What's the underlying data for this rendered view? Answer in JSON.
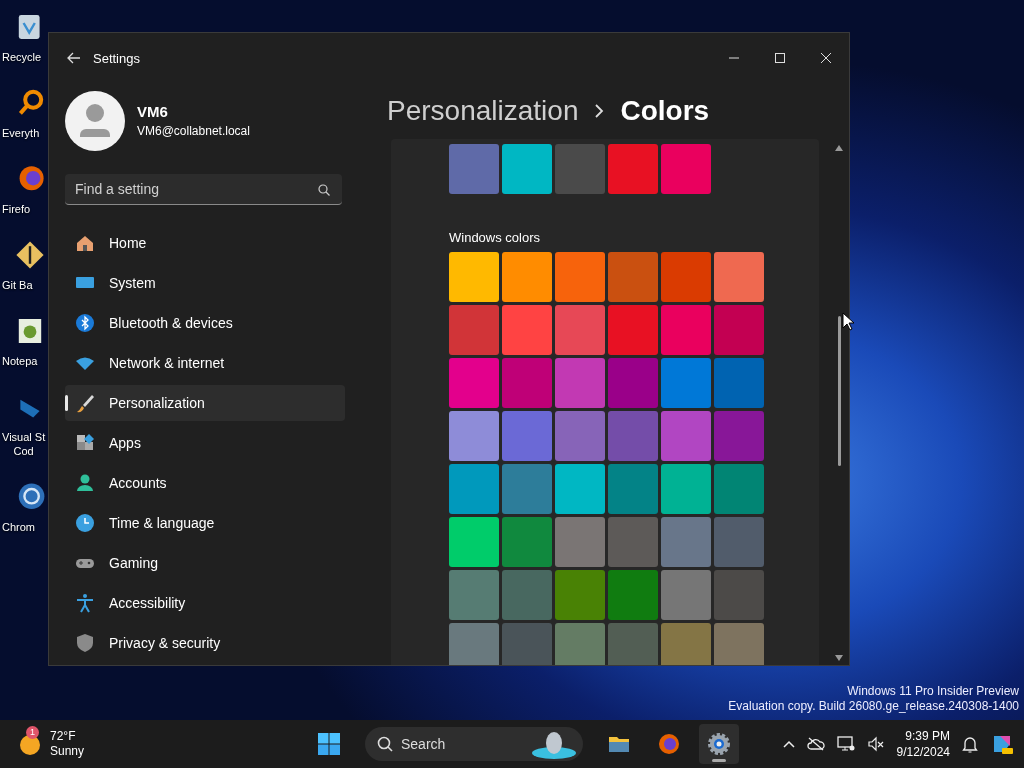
{
  "desktop": {
    "icons": [
      {
        "lines": [
          "Recycle"
        ]
      },
      {
        "lines": [
          "Everyth"
        ]
      },
      {
        "lines": [
          "Firefo"
        ]
      },
      {
        "lines": [
          "Git Ba"
        ]
      },
      {
        "lines": [
          "Notepa"
        ]
      },
      {
        "lines": [
          "Visual St",
          "Cod"
        ]
      },
      {
        "lines": [
          "Chrom"
        ]
      }
    ],
    "watermark": [
      "Windows 11 Pro Insider Preview",
      "Evaluation copy. Build 26080.ge_release.240308-1400"
    ]
  },
  "window": {
    "title": "Settings",
    "user": {
      "name": "VM6",
      "email": "VM6@collabnet.local"
    },
    "search": {
      "placeholder": "Find a setting"
    },
    "sidebar": {
      "items": [
        {
          "label": "Home",
          "selected": false
        },
        {
          "label": "System",
          "selected": false
        },
        {
          "label": "Bluetooth & devices",
          "selected": false
        },
        {
          "label": "Network & internet",
          "selected": false
        },
        {
          "label": "Personalization",
          "selected": true
        },
        {
          "label": "Apps",
          "selected": false
        },
        {
          "label": "Accounts",
          "selected": false
        },
        {
          "label": "Time & language",
          "selected": false
        },
        {
          "label": "Gaming",
          "selected": false
        },
        {
          "label": "Accessibility",
          "selected": false
        },
        {
          "label": "Privacy & security",
          "selected": false
        }
      ]
    },
    "breadcrumb": [
      "Personalization",
      "Colors"
    ],
    "recent_colors": [
      {
        "color": "#5f6aa8"
      },
      {
        "color": "#00b7c3"
      },
      {
        "color": "#4a4a4a"
      },
      {
        "color": "#e81123"
      },
      {
        "color": "#ea005e"
      }
    ],
    "windows_colors": {
      "title": "Windows colors",
      "swatches": [
        {
          "color": "#ffb900"
        },
        {
          "color": "#ff8c00"
        },
        {
          "color": "#f7630c"
        },
        {
          "color": "#ca5010"
        },
        {
          "color": "#da3b01"
        },
        {
          "color": "#ef6950"
        },
        {
          "color": "#d13438"
        },
        {
          "color": "#ff4343"
        },
        {
          "color": "#e74856"
        },
        {
          "color": "#e81123"
        },
        {
          "color": "#ea005e"
        },
        {
          "color": "#c30052"
        },
        {
          "color": "#e3008c"
        },
        {
          "color": "#bf0077"
        },
        {
          "color": "#c239b3"
        },
        {
          "color": "#9a0089"
        },
        {
          "color": "#0078d7"
        },
        {
          "color": "#0063b1"
        },
        {
          "color": "#8e8cd8"
        },
        {
          "color": "#6b69d6"
        },
        {
          "color": "#8764b8"
        },
        {
          "color": "#744da9"
        },
        {
          "color": "#b146c2"
        },
        {
          "color": "#881798"
        },
        {
          "color": "#0099bc"
        },
        {
          "color": "#2d7d9a"
        },
        {
          "color": "#00b7c3"
        },
        {
          "color": "#038387"
        },
        {
          "color": "#00b294"
        },
        {
          "color": "#018574"
        },
        {
          "color": "#00cc6a"
        },
        {
          "color": "#10893e"
        },
        {
          "color": "#7a7574"
        },
        {
          "color": "#5d5a58"
        },
        {
          "color": "#68768a"
        },
        {
          "color": "#515c6b"
        },
        {
          "color": "#567c73"
        },
        {
          "color": "#486860"
        },
        {
          "color": "#498205"
        },
        {
          "color": "#107c10"
        },
        {
          "color": "#767676"
        },
        {
          "color": "#4c4a48"
        },
        {
          "color": "#69797e"
        },
        {
          "color": "#4a5459"
        },
        {
          "color": "#647c64"
        },
        {
          "color": "#525e54"
        },
        {
          "color": "#847545"
        },
        {
          "color": "#7e735f"
        }
      ]
    }
  },
  "taskbar": {
    "weather": {
      "badge": "1",
      "temperature": "72°F",
      "condition": "Sunny"
    },
    "search": {
      "placeholder": "Search"
    },
    "apps": [
      {
        "selected": false
      },
      {
        "selected": false
      },
      {
        "selected": true
      }
    ],
    "clock": {
      "time": "9:39 PM",
      "date": "9/12/2024"
    }
  }
}
